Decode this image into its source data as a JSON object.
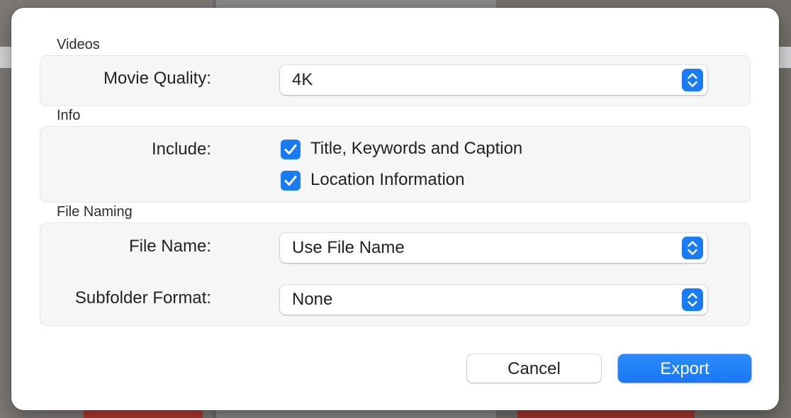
{
  "sections": {
    "videos": {
      "title": "Videos",
      "movie_quality": {
        "label": "Movie Quality:",
        "value": "4K",
        "icon": "up-down-chevron-icon"
      }
    },
    "info": {
      "title": "Info",
      "include_label": "Include:",
      "options": [
        {
          "label": "Title, Keywords and Caption",
          "checked": true
        },
        {
          "label": "Location Information",
          "checked": true
        }
      ]
    },
    "file_naming": {
      "title": "File Naming",
      "file_name": {
        "label": "File Name:",
        "value": "Use File Name",
        "icon": "up-down-chevron-icon"
      },
      "subfolder_format": {
        "label": "Subfolder Format:",
        "value": "None",
        "icon": "up-down-chevron-icon"
      }
    }
  },
  "buttons": {
    "cancel": "Cancel",
    "export": "Export"
  },
  "colors": {
    "accent": "#1a7cf5",
    "sheet_background": "#ffffff",
    "group_background": "#f6f6f6"
  }
}
